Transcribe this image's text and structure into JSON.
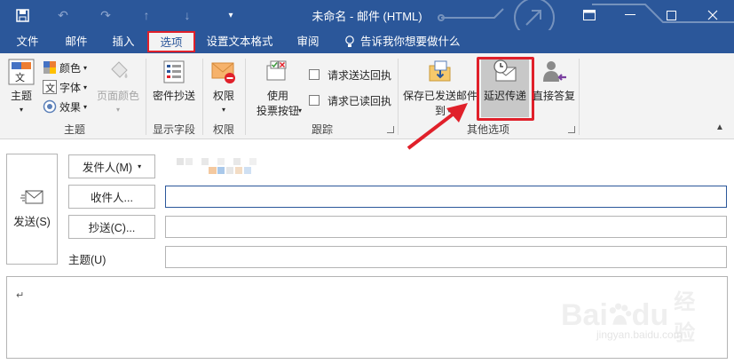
{
  "window": {
    "title": "未命名 - 邮件 (HTML)",
    "theme_color": "#2b579a",
    "highlight_color": "#e0202a"
  },
  "quick_access": {
    "save_icon": "save-icon",
    "undo_icon": "undo-icon",
    "redo_icon": "redo-icon",
    "up_icon": "up-arrow-icon",
    "down_icon": "down-arrow-icon",
    "customize_icon": "customize-icon"
  },
  "tabs": [
    {
      "label": "文件"
    },
    {
      "label": "邮件"
    },
    {
      "label": "插入"
    },
    {
      "label": "选项",
      "active": true
    },
    {
      "label": "设置文本格式"
    },
    {
      "label": "审阅"
    }
  ],
  "tell_me": "告诉我你想要做什么",
  "ribbon": {
    "theme_group": {
      "theme": "主题",
      "colors": "颜色",
      "fonts": "字体",
      "effects": "效果",
      "page_color": "页面颜色",
      "label": "主题"
    },
    "show_fields_group": {
      "bcc": "密件抄送",
      "label": "显示字段"
    },
    "permission_group": {
      "permission": "权限",
      "label": "权限"
    },
    "tracking_group": {
      "voting_line1": "使用",
      "voting_line2": "投票按钮",
      "request_delivery": "请求送达回执",
      "request_read": "请求已读回执",
      "label": "跟踪"
    },
    "more_options_group": {
      "save_sent_line1": "保存已发送邮件",
      "save_sent_line2": "到",
      "delay_delivery": "延迟传递",
      "direct_replies": "直接答复",
      "label": "其他选项"
    }
  },
  "compose": {
    "send": "发送(S)",
    "from": "发件人(M)",
    "to": "收件人...",
    "cc": "抄送(C)...",
    "subject": "主题(U)",
    "body_mark": "↵"
  },
  "watermark": {
    "brand": "Bai",
    "brand2": "du",
    "brand_cn": "经验",
    "url": "jingyan.baidu.com"
  }
}
